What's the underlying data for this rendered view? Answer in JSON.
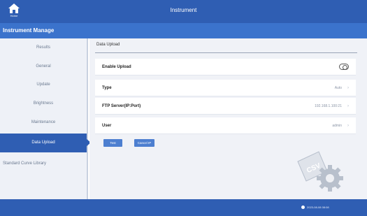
{
  "app": {
    "title": "Instrument",
    "home_label": "Home"
  },
  "section_title": "Instrument Manage",
  "sidebar": {
    "items": [
      {
        "label": "Results"
      },
      {
        "label": "General"
      },
      {
        "label": "Update"
      },
      {
        "label": "Brightness"
      },
      {
        "label": "Maintenance"
      },
      {
        "label": "Data Upload"
      },
      {
        "label": "Standard Curve Library"
      }
    ]
  },
  "panel": {
    "title": "Data Upload",
    "rows": [
      {
        "label": "Enable Upload",
        "value": ""
      },
      {
        "label": "Type",
        "value": "Auto"
      },
      {
        "label": "FTP Server(IP:Port)",
        "value": "192.168.1.100:21"
      },
      {
        "label": "User",
        "value": "admin"
      }
    ],
    "buttons": {
      "test": "Test",
      "cancel": "Cancel IP"
    },
    "graphic_label": "CSV"
  },
  "footer": {
    "status": "2023-08-08 08:08"
  },
  "colors": {
    "primary": "#2f5eb3",
    "secondary": "#3b73cc"
  }
}
